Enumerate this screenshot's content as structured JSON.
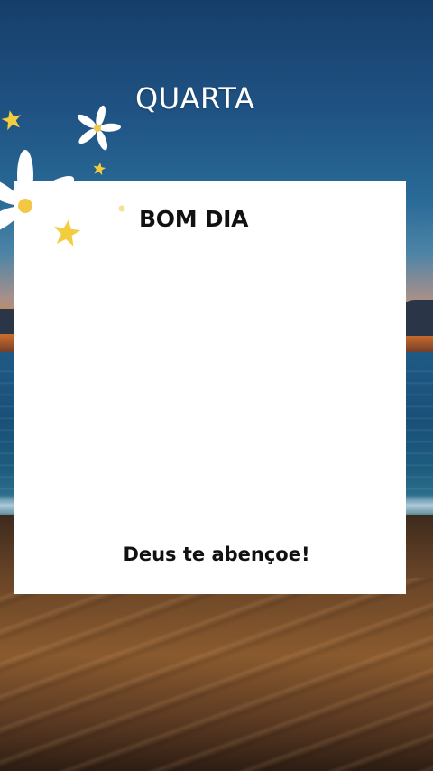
{
  "header": {
    "day": "QUARTA"
  },
  "card": {
    "greeting": "BOM DIA",
    "blessing": "Deus te abençoe!"
  },
  "decorations": {
    "flower_petal_color": "#ffffff",
    "flower_center_color": "#f2c744",
    "star_color": "#f3cd3f"
  },
  "colors": {
    "card_background": "#ffffff",
    "text_dark": "#111111",
    "title_light": "#ffffff"
  }
}
